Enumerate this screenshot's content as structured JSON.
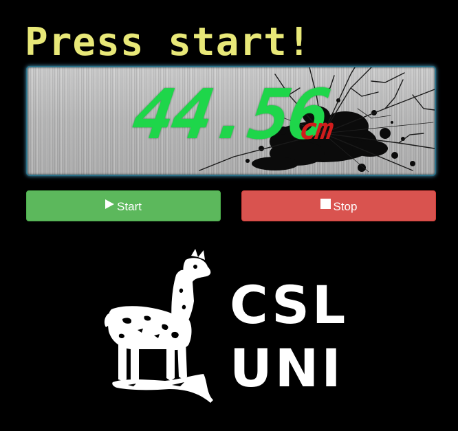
{
  "title": "Press start!",
  "display": {
    "reading": "44.56",
    "unit": "cm"
  },
  "controls": {
    "start_label": "Start",
    "start_icon": "play-icon",
    "stop_label": "Stop",
    "stop_icon": "stop-icon"
  },
  "logo": {
    "line1": "CSL",
    "line2": "UNI",
    "mark": "llama-icon"
  },
  "colors": {
    "background": "#000000",
    "title": "#e8e878",
    "reading": "#1ed64a",
    "unit": "#d11c1c",
    "start_button": "#5cb85c",
    "stop_button": "#d9534f",
    "display_glow": "#50aad2"
  }
}
